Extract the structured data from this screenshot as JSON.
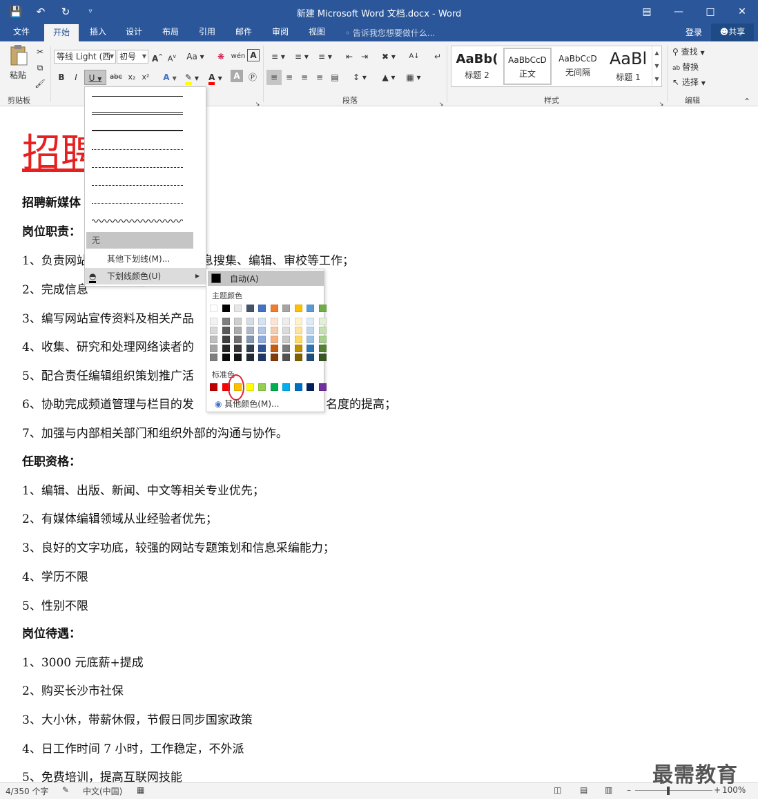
{
  "window": {
    "title": "新建 Microsoft Word 文档.docx - Word",
    "qat_icons": [
      "save-icon",
      "undo-icon",
      "redo-icon",
      "customize-icon"
    ]
  },
  "tabs": [
    "文件",
    "开始",
    "插入",
    "设计",
    "布局",
    "引用",
    "邮件",
    "审阅",
    "视图"
  ],
  "active_tab": "开始",
  "tell_me": "告诉我您想要做什么...",
  "login": "登录",
  "share": "共享",
  "ribbon": {
    "clipboard": {
      "paste": "粘贴",
      "label": "剪贴板"
    },
    "font": {
      "name": "等线 Light (西",
      "size": "初号",
      "grow": "A",
      "shrink": "A",
      "case": "Aa",
      "bold": "B",
      "italic": "I",
      "underline": "U",
      "strike": "abc",
      "sub": "x₂",
      "sup": "x²"
    },
    "paragraph": {
      "label": "段落"
    },
    "styles": {
      "label": "样式",
      "items": [
        {
          "preview": "AaBb(",
          "name": "标题 2"
        },
        {
          "preview": "AaBbCcD",
          "name": "正文"
        },
        {
          "preview": "AaBbCcD",
          "name": "无间隔"
        },
        {
          "preview": "AaBl",
          "name": "标题 1"
        }
      ]
    },
    "editing": {
      "find": "查找",
      "replace": "替换",
      "select": "选择",
      "label": "编辑"
    }
  },
  "underline_menu": {
    "none": "无",
    "more": "其他下划线(M)...",
    "color": "下划线颜色(U)"
  },
  "color_menu": {
    "auto": "自动(A)",
    "theme_label": "主题颜色",
    "standard_label": "标准色",
    "more": "其他颜色(M)...",
    "theme_top": [
      "#ffffff",
      "#000000",
      "#e7e6e6",
      "#44546a",
      "#4472c4",
      "#ed7d31",
      "#a5a5a5",
      "#ffc000",
      "#5b9bd5",
      "#70ad47"
    ],
    "theme_shades": [
      [
        "#f2f2f2",
        "#7f7f7f",
        "#d0cece",
        "#d6dce4",
        "#d9e2f3",
        "#fbe5d5",
        "#ededed",
        "#fff2cc",
        "#deebf6",
        "#e2efd9"
      ],
      [
        "#d8d8d8",
        "#595959",
        "#aeabab",
        "#adb9ca",
        "#b4c6e7",
        "#f7cbac",
        "#dbdbdb",
        "#fee599",
        "#bdd7ee",
        "#c5e0b3"
      ],
      [
        "#bfbfbf",
        "#3f3f3f",
        "#757070",
        "#8496b0",
        "#8eaadb",
        "#f4b183",
        "#c9c9c9",
        "#ffd965",
        "#9cc3e5",
        "#a8d08d"
      ],
      [
        "#a5a5a5",
        "#262626",
        "#3a3838",
        "#323f4f",
        "#2f5496",
        "#c55a11",
        "#7b7b7b",
        "#bf9000",
        "#2e75b5",
        "#538135"
      ],
      [
        "#7f7f7f",
        "#0c0c0c",
        "#171616",
        "#222a35",
        "#1f3864",
        "#833c0b",
        "#525252",
        "#7f6000",
        "#1e4e79",
        "#375623"
      ]
    ],
    "standard": [
      "#c00000",
      "#ff0000",
      "#ffc000",
      "#ffff00",
      "#92d050",
      "#00b050",
      "#00b0f0",
      "#0070c0",
      "#002060",
      "#7030a0"
    ]
  },
  "document": {
    "title": "招聘",
    "lines": [
      {
        "text": "招聘新媒体",
        "bold": true
      },
      {
        "text": "岗位职责：",
        "bold": true
      },
      {
        "text": "1、负责网站",
        "tail": "息搜集、编辑、审校等工作；"
      },
      {
        "text": "2、完成信息",
        "tail": ""
      },
      {
        "text": "3、编写网站宣传资料及相关产品",
        "tail": ""
      },
      {
        "text": "4、收集、研究和处理网络读者的",
        "tail": ""
      },
      {
        "text": "5、配合责任编辑组织策划推广活",
        "tail": ""
      },
      {
        "text": "6、协助完成频道管理与栏目的发",
        "tail": "名度的提高；"
      },
      {
        "text": "7、加强与内部相关部门和组织外部的沟通与协作。"
      },
      {
        "text": "任职资格：",
        "bold": true
      },
      {
        "text": "1、编辑、出版、新闻、中文等相关专业优先；"
      },
      {
        "text": "2、有媒体编辑领域从业经验者优先；"
      },
      {
        "text": "3、良好的文字功底，较强的网站专题策划和信息采编能力；"
      },
      {
        "text": "4、学历不限"
      },
      {
        "text": "5、性别不限"
      },
      {
        "text": "岗位待遇：",
        "bold": true
      },
      {
        "text": "1、3000 元底薪+提成"
      },
      {
        "text": "2、购买长沙市社保"
      },
      {
        "text": "3、大小休，带薪休假，节假日同步国家政策"
      },
      {
        "text": "4、日工作时间 7 小时，工作稳定，不外派"
      },
      {
        "text": "5、免费培训，提高互联网技能"
      }
    ]
  },
  "status": {
    "words": "4/350 个字",
    "lang": "中文(中国)",
    "zoom": "100%"
  },
  "watermark": "最需教育"
}
